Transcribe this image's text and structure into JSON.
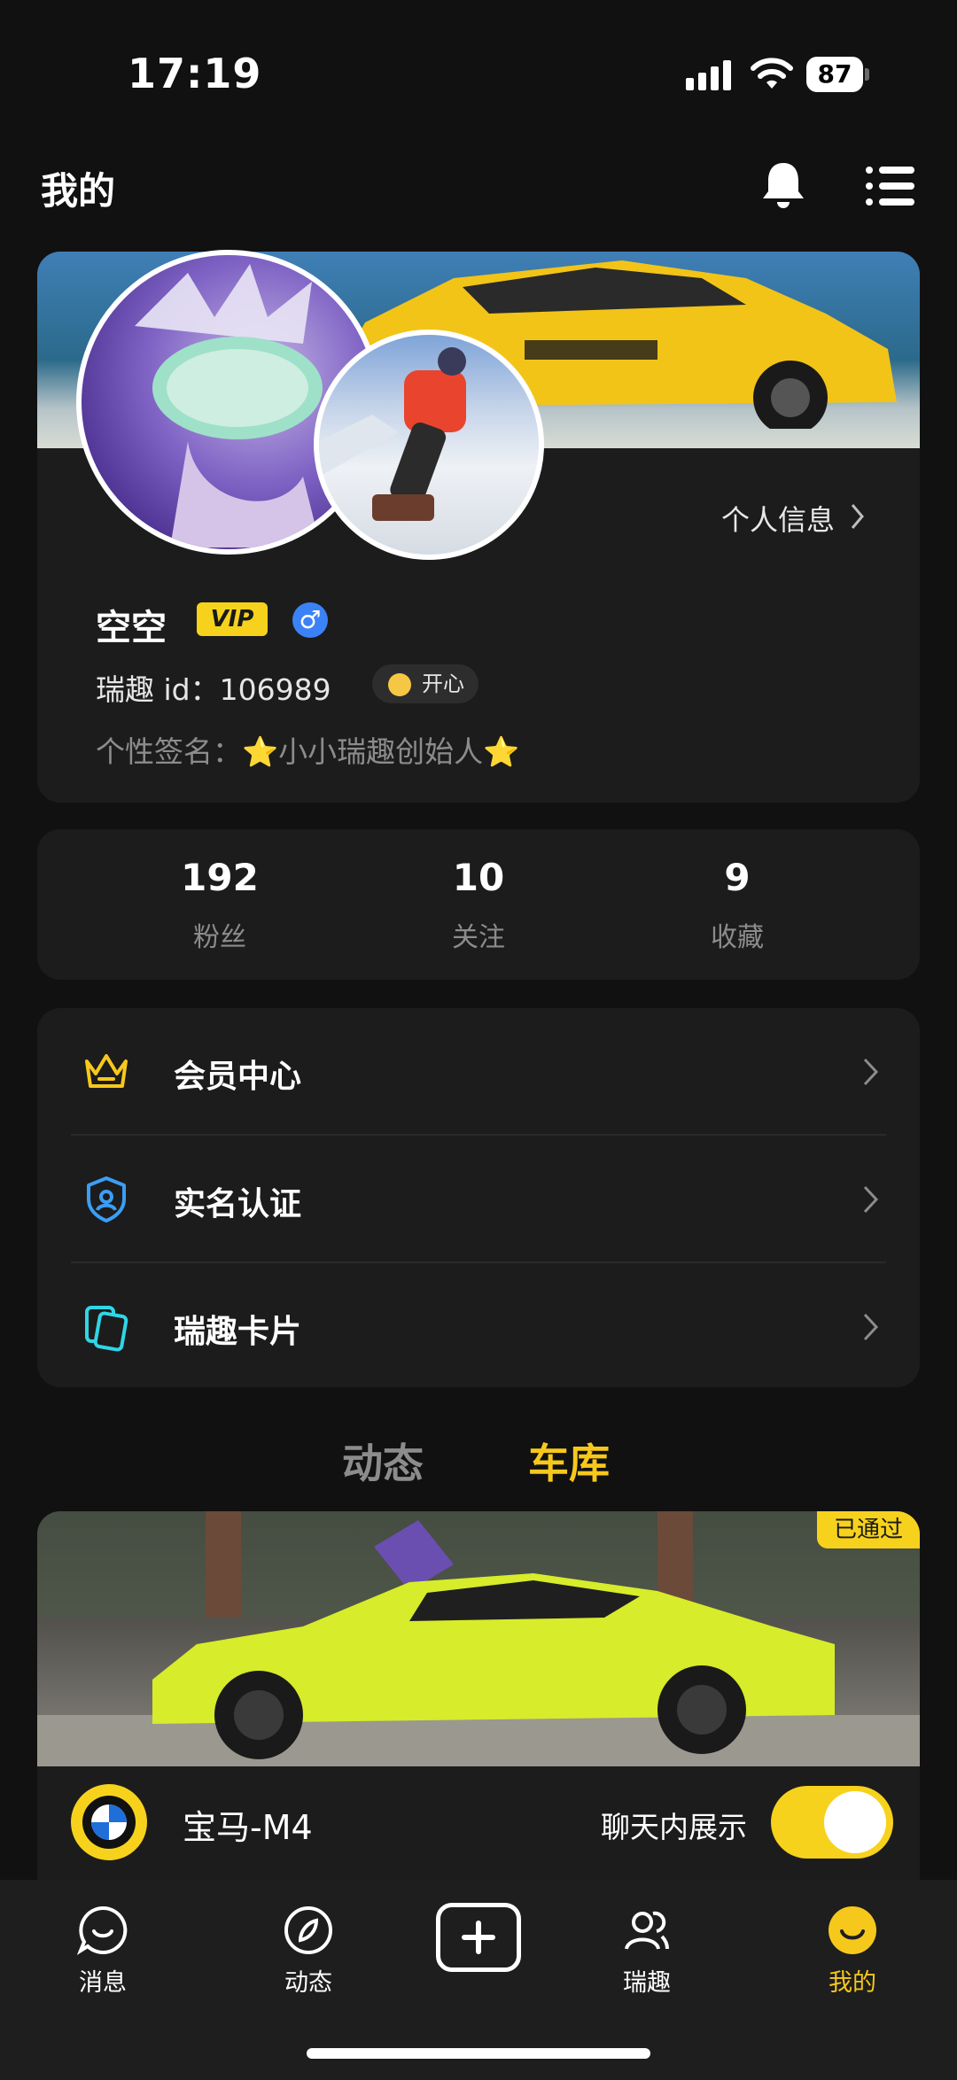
{
  "status_bar": {
    "time": "17:19",
    "battery": "87"
  },
  "header": {
    "title": "我的"
  },
  "profile": {
    "link_label": "个人信息",
    "username": "空空",
    "vip_label": "VIP",
    "gender_symbol": "♂",
    "id_text": "瑞趣 id：106989",
    "mood": "开心",
    "signature": "个性签名：⭐小小瑞趣创始人⭐"
  },
  "stats": [
    {
      "value": "192",
      "label": "粉丝"
    },
    {
      "value": "10",
      "label": "关注"
    },
    {
      "value": "9",
      "label": "收藏"
    }
  ],
  "menu": [
    {
      "label": "会员中心",
      "icon": "crown-icon",
      "color": "#f7c81c"
    },
    {
      "label": "实名认证",
      "icon": "shield-user-icon",
      "color": "#3b9ef5"
    },
    {
      "label": "瑞趣卡片",
      "icon": "cards-icon",
      "color": "#2fd6e6"
    }
  ],
  "tabs": {
    "dynamic": "动态",
    "garage": "车库",
    "active": "车库"
  },
  "car": {
    "status": "已通过",
    "name": "宝马-M4",
    "brand_icon": "bmw-logo",
    "chat_display_label": "聊天内展示",
    "chat_display_on": true,
    "paint_color": "#d7ec2a"
  },
  "bottom_nav": {
    "messages": "消息",
    "dynamic": "动态",
    "community": "瑞趣",
    "mine": "我的",
    "active": "我的"
  },
  "colors": {
    "accent": "#f7c81c",
    "background": "#111111",
    "card": "#1c1c1c"
  }
}
